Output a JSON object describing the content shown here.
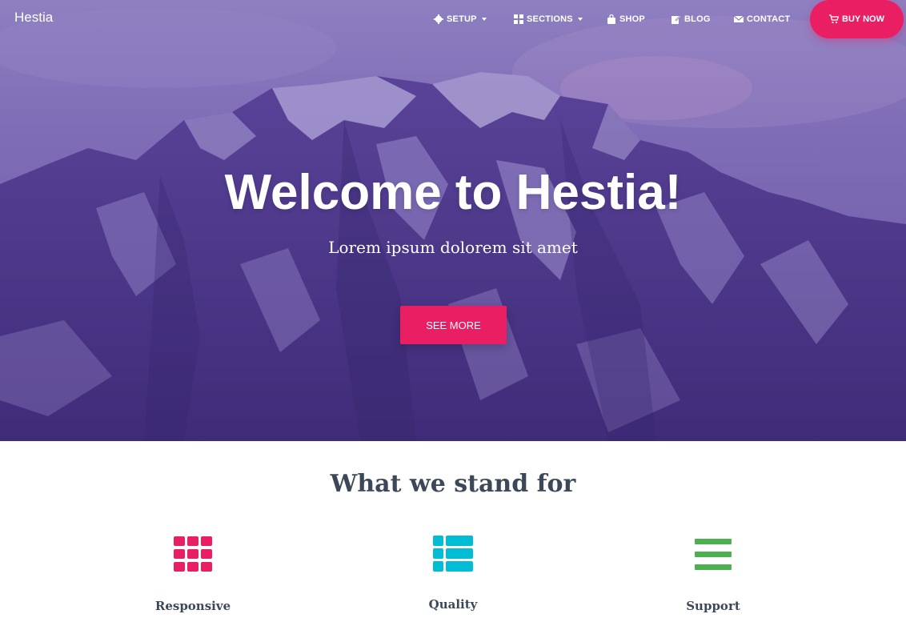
{
  "brand": "Hestia",
  "nav": {
    "setup": "SETUP",
    "sections": "SECTIONS",
    "shop": "SHOP",
    "blog": "BLOG",
    "contact": "CONTACT",
    "buy_now": "BUY NOW"
  },
  "hero": {
    "title": "Welcome to Hestia!",
    "subtitle": "Lorem ipsum dolorem sit amet",
    "cta": "SEE MORE"
  },
  "features": {
    "title": "What we stand for",
    "items": [
      {
        "label": "Responsive",
        "icon": "grid-icon",
        "color": "#e91e63"
      },
      {
        "label": "Quality",
        "icon": "list-icon",
        "color": "#00bcd4"
      },
      {
        "label": "Support",
        "icon": "bars-icon",
        "color": "#4caf50"
      }
    ]
  },
  "colors": {
    "accent": "#e91e63",
    "hero_tint": "#5b46a0",
    "heading": "#3c4858"
  }
}
